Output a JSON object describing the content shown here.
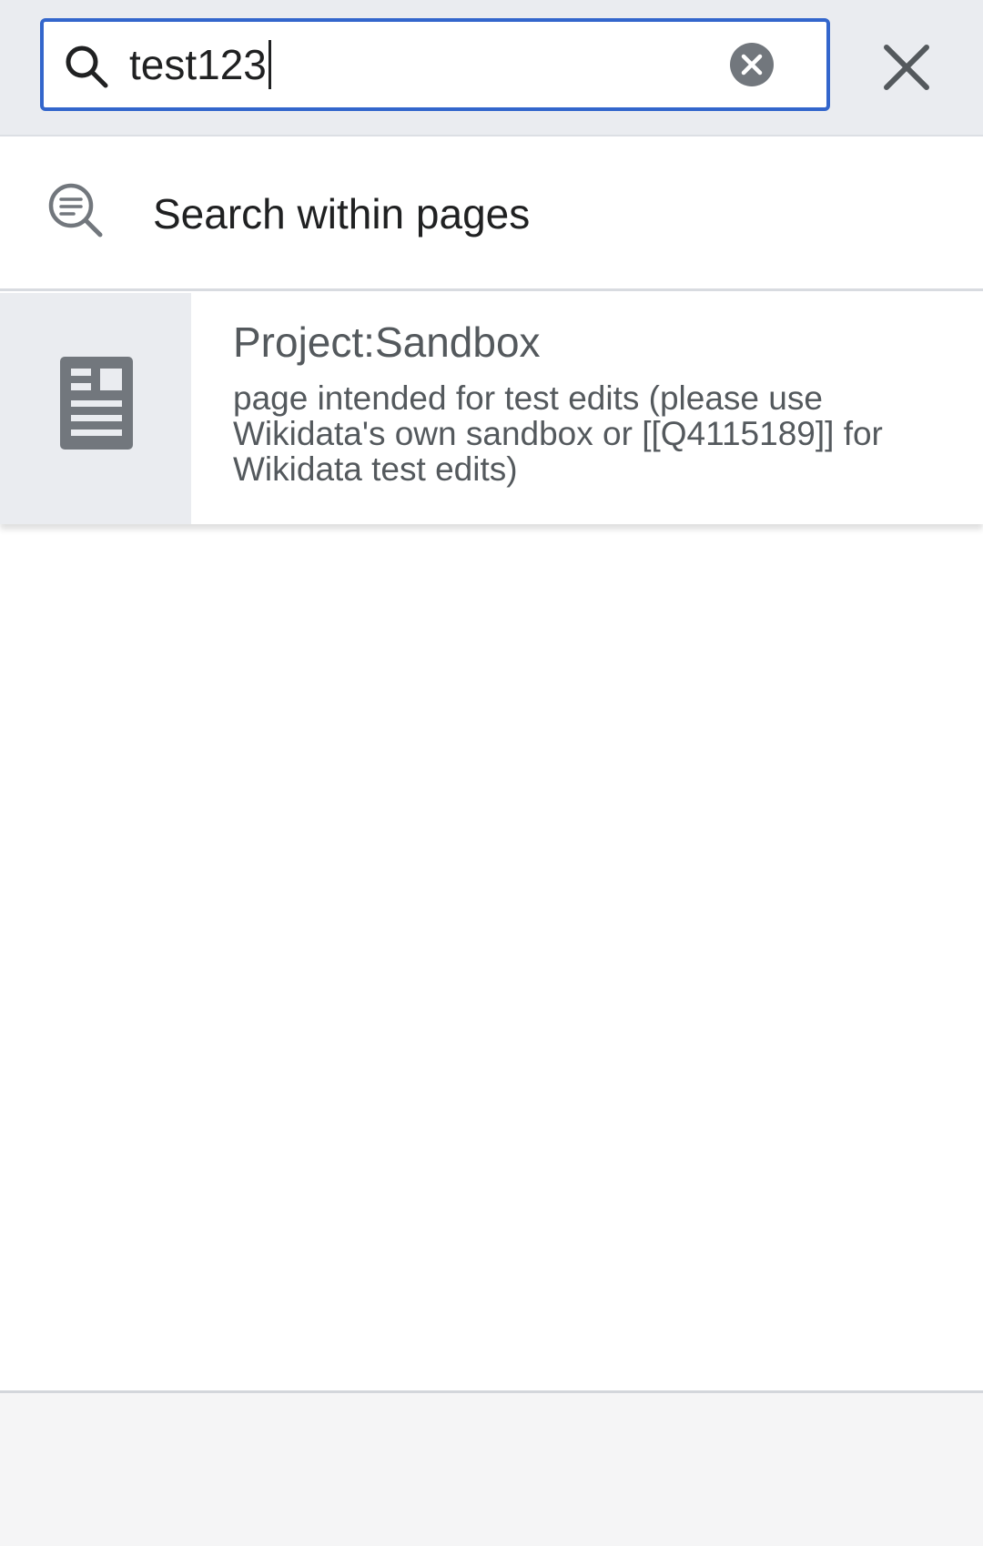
{
  "search": {
    "value": "test123",
    "icon": "search-icon",
    "clear_icon": "clear-circle-icon",
    "close_icon": "close-icon"
  },
  "within": {
    "label": "Search within pages",
    "icon": "search-in-text-icon"
  },
  "results": [
    {
      "title": "Project:Sandbox",
      "description": "page intended for test edits (please use Wikidata's own sandbox or [[Q4115189]] for Wikidata test edits)",
      "icon": "article-icon"
    }
  ],
  "colors": {
    "accent": "#3366cc",
    "header_bg": "#eaecf0",
    "text_primary": "#202122",
    "text_secondary": "#54595d",
    "icon_gray": "#72777d"
  }
}
